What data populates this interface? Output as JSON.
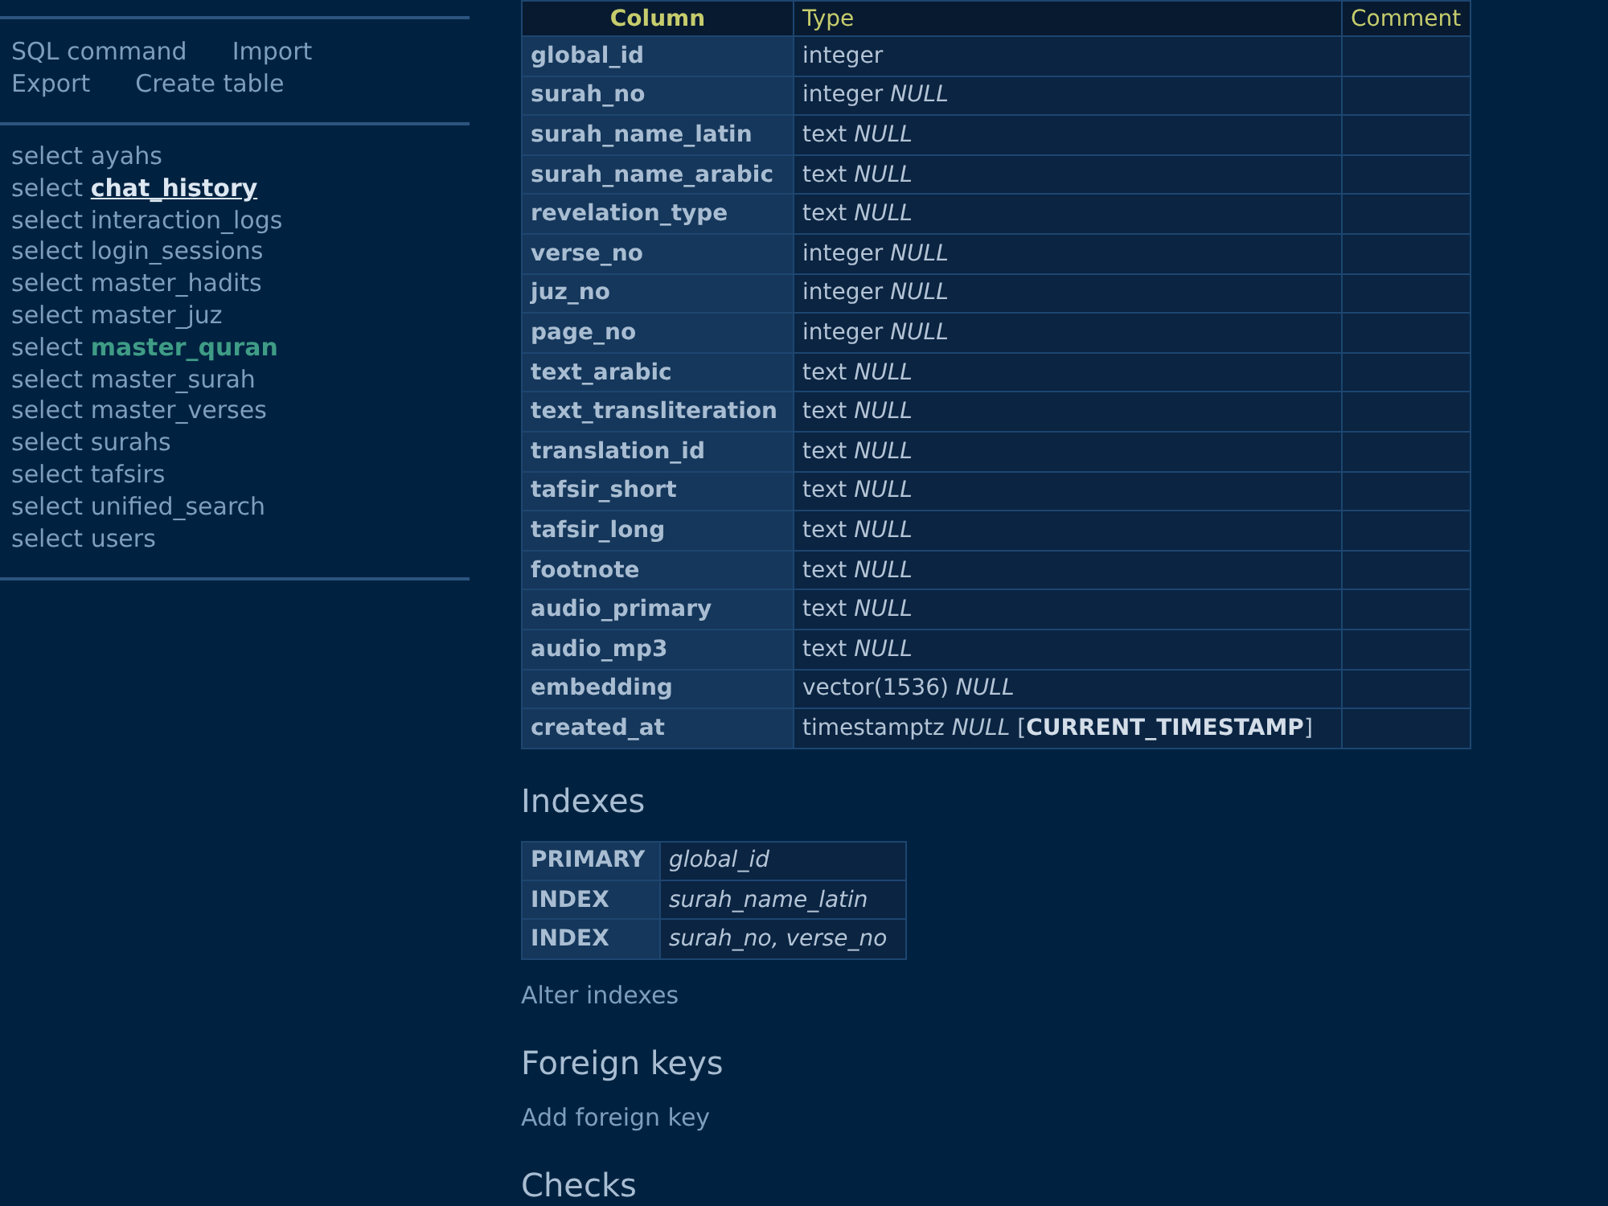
{
  "sidebar": {
    "links": [
      {
        "label": "SQL command"
      },
      {
        "label": "Import"
      },
      {
        "label": "Export"
      },
      {
        "label": "Create table"
      }
    ],
    "tables": [
      {
        "action": "select",
        "name": "ayahs",
        "selected": false,
        "hovered": false
      },
      {
        "action": "select",
        "name": "chat_history",
        "selected": false,
        "hovered": true
      },
      {
        "action": "select",
        "name": "interaction_logs",
        "selected": false,
        "hovered": false
      },
      {
        "action": "select",
        "name": "login_sessions",
        "selected": false,
        "hovered": false
      },
      {
        "action": "select",
        "name": "master_hadits",
        "selected": false,
        "hovered": false
      },
      {
        "action": "select",
        "name": "master_juz",
        "selected": false,
        "hovered": false
      },
      {
        "action": "select",
        "name": "master_quran",
        "selected": true,
        "hovered": false
      },
      {
        "action": "select",
        "name": "master_surah",
        "selected": false,
        "hovered": false
      },
      {
        "action": "select",
        "name": "master_verses",
        "selected": false,
        "hovered": false
      },
      {
        "action": "select",
        "name": "surahs",
        "selected": false,
        "hovered": false
      },
      {
        "action": "select",
        "name": "tafsirs",
        "selected": false,
        "hovered": false
      },
      {
        "action": "select",
        "name": "unified_search",
        "selected": false,
        "hovered": false
      },
      {
        "action": "select",
        "name": "users",
        "selected": false,
        "hovered": false
      }
    ]
  },
  "structure": {
    "columns": [
      "Column",
      "Type",
      "Comment"
    ],
    "rows": [
      {
        "name": "global_id",
        "type": "integer"
      },
      {
        "name": "surah_no",
        "type": "integer *NULL*"
      },
      {
        "name": "surah_name_latin",
        "type": "text *NULL*"
      },
      {
        "name": "surah_name_arabic",
        "type": "text *NULL*"
      },
      {
        "name": "revelation_type",
        "type": "text *NULL*"
      },
      {
        "name": "verse_no",
        "type": "integer *NULL*"
      },
      {
        "name": "juz_no",
        "type": "integer *NULL*"
      },
      {
        "name": "page_no",
        "type": "integer *NULL*"
      },
      {
        "name": "text_arabic",
        "type": "text *NULL*"
      },
      {
        "name": "text_transliteration",
        "type": "text *NULL*"
      },
      {
        "name": "translation_id",
        "type": "text *NULL*"
      },
      {
        "name": "tafsir_short",
        "type": "text *NULL*"
      },
      {
        "name": "tafsir_long",
        "type": "text *NULL*"
      },
      {
        "name": "footnote",
        "type": "text *NULL*"
      },
      {
        "name": "audio_primary",
        "type": "text *NULL*"
      },
      {
        "name": "audio_mp3",
        "type": "text *NULL*"
      },
      {
        "name": "embedding",
        "type": "vector(1536) *NULL*"
      },
      {
        "name": "created_at",
        "type": "timestamptz *NULL* [**CURRENT_TIMESTAMP**]"
      }
    ]
  },
  "sections": [
    {
      "heading": "Indexes",
      "indexes": [
        {
          "label": "PRIMARY",
          "columns": "global_id"
        },
        {
          "label": "INDEX",
          "columns": "surah_name_latin"
        },
        {
          "label": "INDEX",
          "columns": "surah_no, verse_no"
        }
      ],
      "link": "Alter indexes"
    },
    {
      "heading": "Foreign keys",
      "link": "Add foreign key"
    },
    {
      "heading": "Checks"
    }
  ]
}
